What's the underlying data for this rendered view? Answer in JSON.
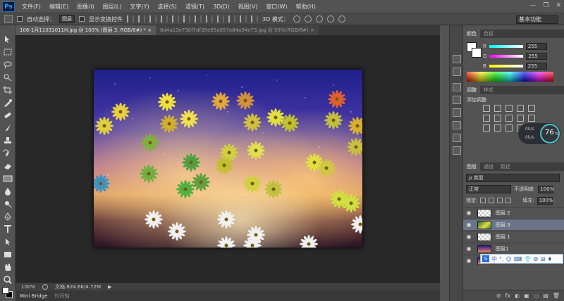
{
  "app": {
    "logo": "Ps"
  },
  "menu": [
    "文件(F)",
    "编辑(E)",
    "图像(I)",
    "图层(L)",
    "文字(Y)",
    "选择(S)",
    "滤镜(T)",
    "3D(D)",
    "视图(V)",
    "窗口(W)",
    "帮助(H)"
  ],
  "window_controls": {
    "minimize": "—",
    "restore": "❐",
    "close": "✕"
  },
  "options": {
    "auto_select_label": "自动选择：",
    "auto_select_value": "图层",
    "show_transform_label": "显示变换控件",
    "mode_3d_label": "3D 模式：",
    "workspace": "基本功能"
  },
  "tabs": [
    {
      "label": "106-1月11031011H.jpg @ 100% (图层 3, RGB/8#) * ×"
    },
    {
      "label": "8d4a13e730f7df35e95a957e84a94e73.jpg @ 50%(RGB/8#) ×"
    }
  ],
  "status": {
    "zoom": "100%",
    "doc": "文档:824.6K/4.72M",
    "arrow": "▶"
  },
  "bottom_tabs": [
    {
      "label": "Mini Bridge"
    },
    {
      "label": "时间轴"
    }
  ],
  "color_panel": {
    "tabs": [
      "颜色",
      "色板"
    ],
    "channels": [
      {
        "name": "R",
        "value": "255",
        "color": "#ff5a8a"
      },
      {
        "name": "G",
        "value": "255",
        "color": "#4cd0a0"
      },
      {
        "name": "B",
        "value": "255",
        "color": "#c0c040"
      }
    ]
  },
  "adjustments": {
    "tabs": [
      "调整",
      "样式"
    ],
    "title": "添加调整"
  },
  "dial": {
    "percent": "76",
    "percent_unit": "%",
    "up": "0k/s",
    "down": "0k/s"
  },
  "layers_panel": {
    "tabs": [
      "图层",
      "通道",
      "路径"
    ],
    "filter": "ρ 类型",
    "blend_mode": "正常",
    "opacity_label": "不透明度:",
    "opacity_value": "100%",
    "lock_label": "锁定:",
    "fill_label": "填充:",
    "fill_value": "100%",
    "layers": [
      {
        "name": "图层 2",
        "thumb": "checker",
        "selected": false,
        "italic": false
      },
      {
        "name": "图层 3",
        "thumb": "flow",
        "selected": true,
        "italic": false
      },
      {
        "name": "图层 1",
        "thumb": "checker",
        "selected": false,
        "italic": false
      },
      {
        "name": "图层1",
        "thumb": "night",
        "selected": false,
        "italic": false
      },
      {
        "name": "背景",
        "thumb": "night",
        "selected": false,
        "italic": true
      }
    ]
  },
  "ime": {
    "logo": "S",
    "items": [
      "中",
      "°,",
      "☺",
      "⌨",
      "👕",
      "⚙",
      "⊞",
      "♦"
    ]
  },
  "layers_footer": [
    "⊘",
    "fx",
    "◐",
    "▣",
    "▭",
    "▤",
    "🗑"
  ]
}
